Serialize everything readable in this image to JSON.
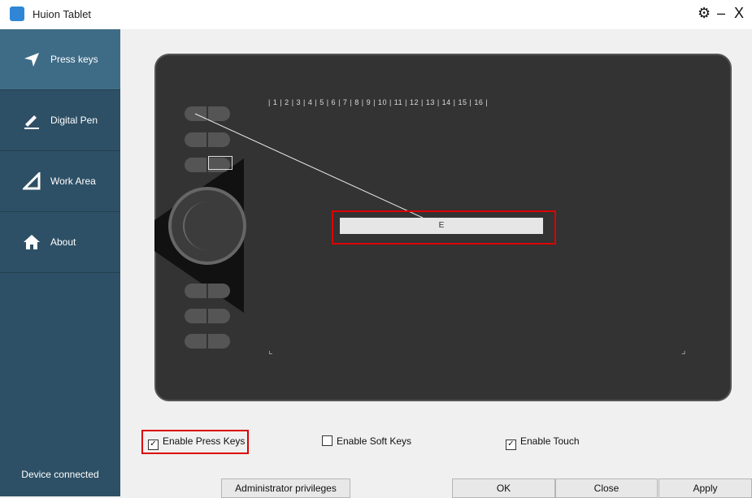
{
  "window": {
    "title": "Huion Tablet",
    "settings_icon": "gear-icon",
    "minimize": "–",
    "close": "X"
  },
  "sidebar": {
    "items": [
      {
        "label": "Press keys",
        "icon": "send-icon",
        "active": true
      },
      {
        "label": "Digital Pen",
        "icon": "pen-icon"
      },
      {
        "label": "Work Area",
        "icon": "triangle-icon"
      },
      {
        "label": "About",
        "icon": "home-icon"
      }
    ],
    "status": "Device connected"
  },
  "ruler": {
    "text": "| 1 | 2 | 3 | 4 | 5 | 6 | 7 | 8 | 9 | 10 | 11 | 12 | 13 | 14 | 15 | 16 |"
  },
  "key_assignment": {
    "value": "E"
  },
  "options": {
    "enable_press_keys": {
      "label": "Enable Press Keys",
      "checked": true
    },
    "enable_soft_keys": {
      "label": "Enable Soft Keys",
      "checked": false
    },
    "enable_touch": {
      "label": "Enable Touch",
      "checked": true
    }
  },
  "footer": {
    "admin": "Administrator privileges",
    "ok": "OK",
    "close": "Close",
    "apply": "Apply"
  },
  "colors": {
    "sidebar": "#2d5066",
    "sidebar_active": "#3e6c87",
    "highlight": "#d00000",
    "tablet": "#333333"
  }
}
